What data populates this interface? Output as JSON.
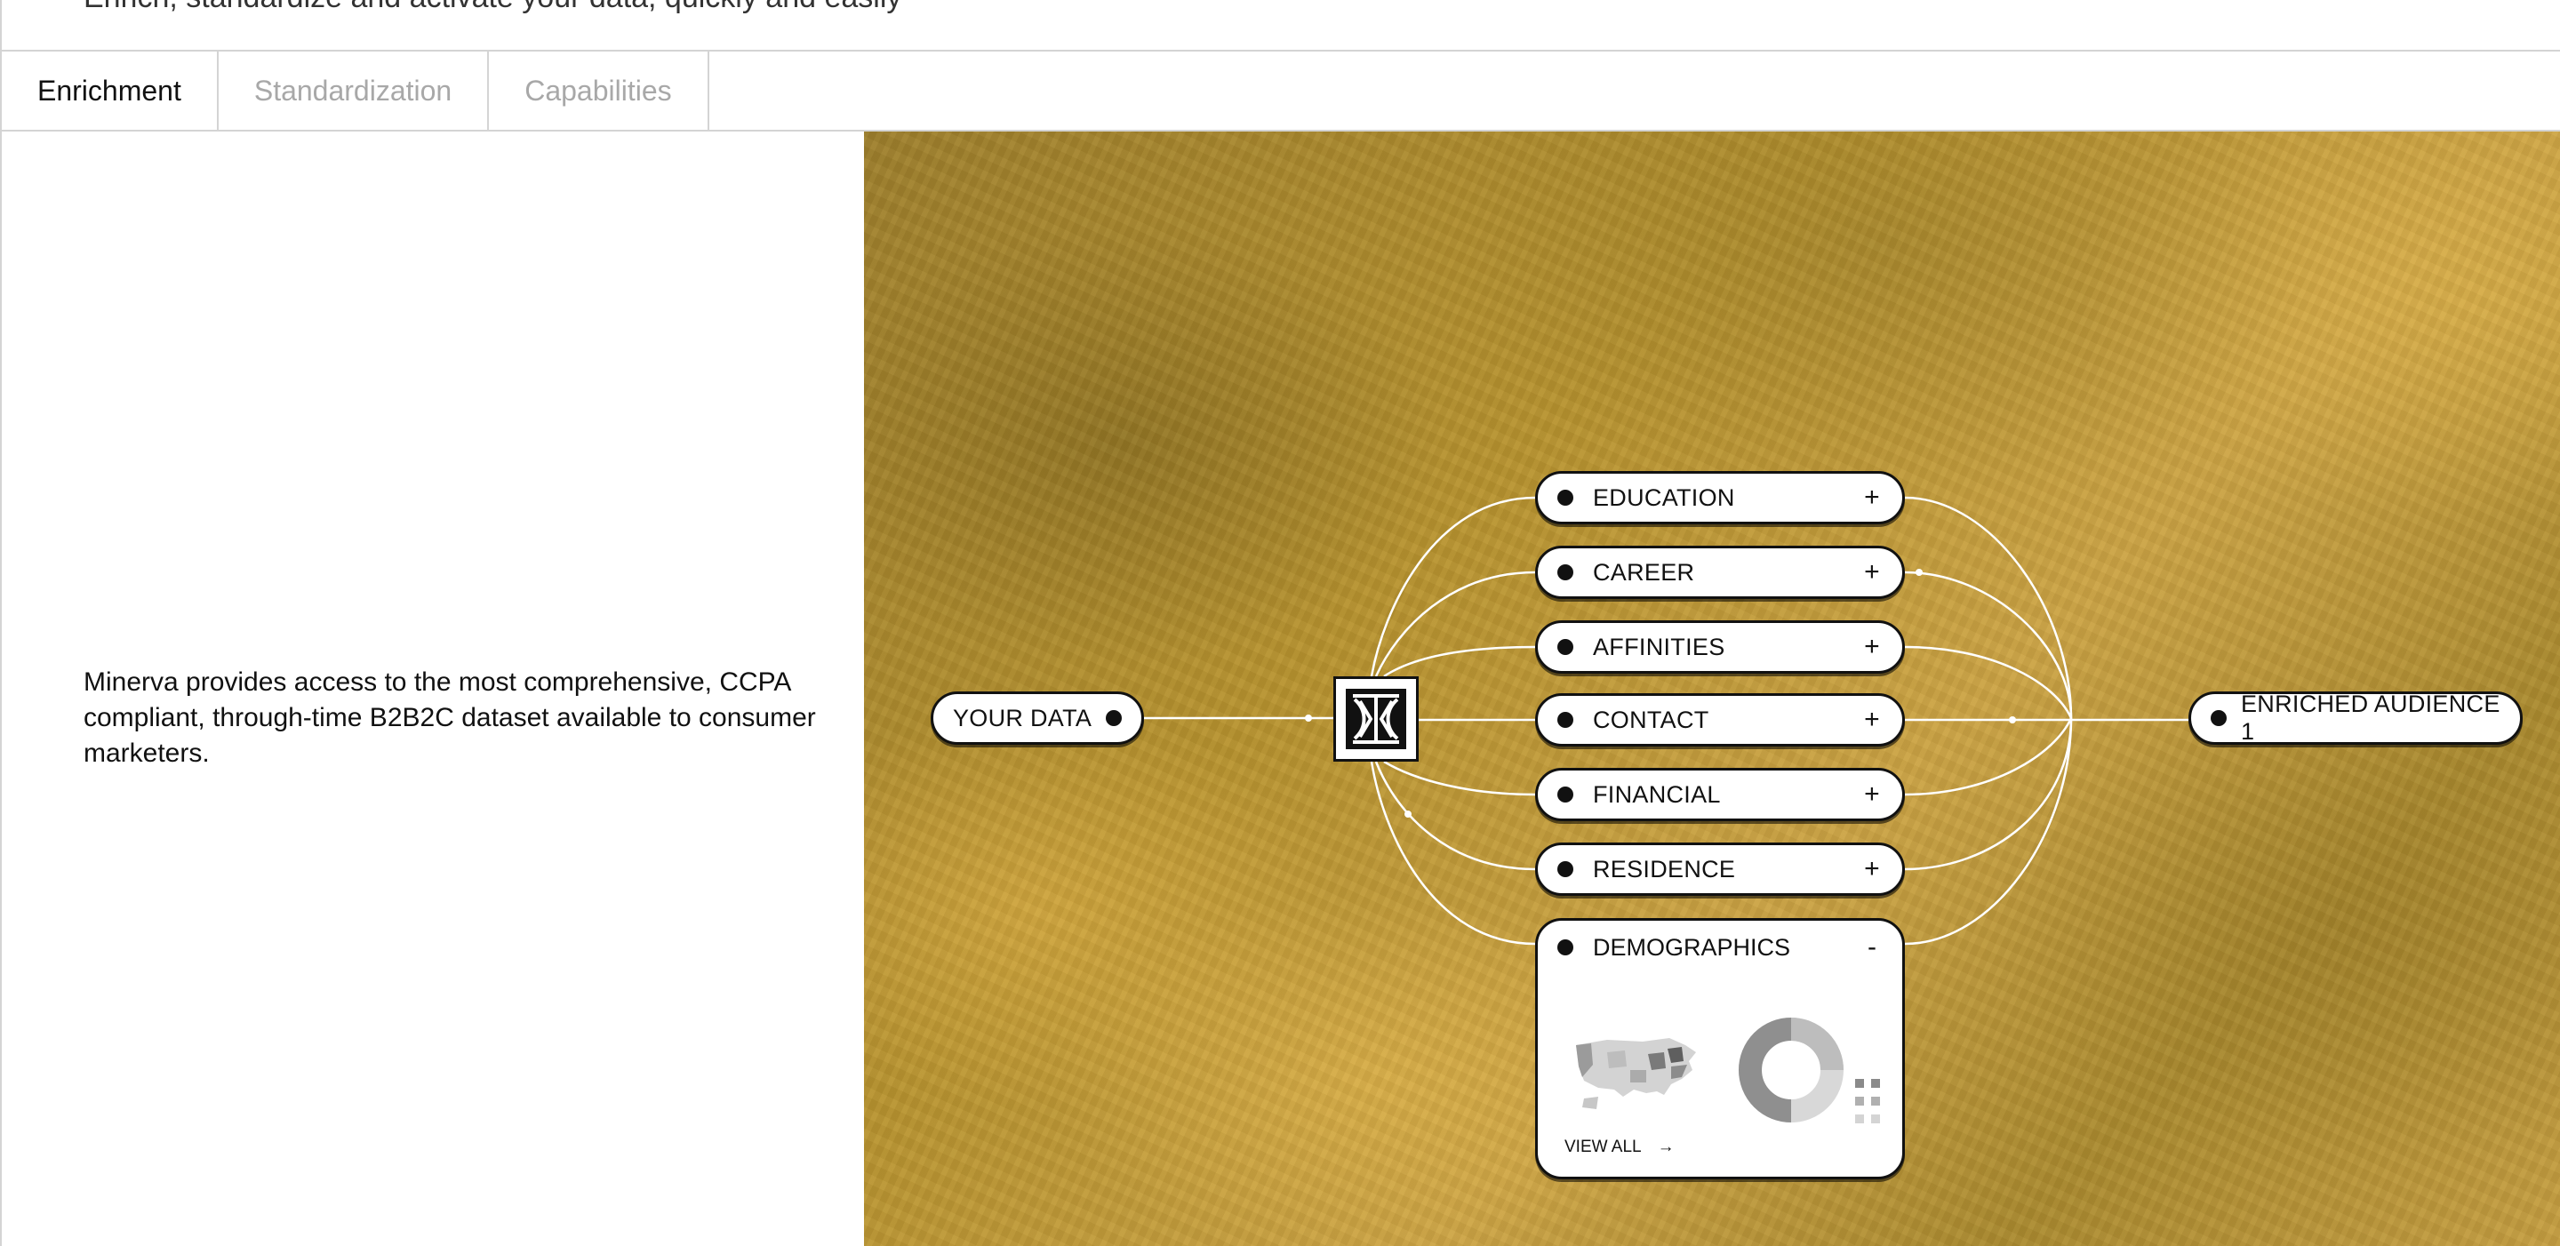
{
  "header": {
    "partial_text": "Enrich, standardize and activate your data, quickly and easily"
  },
  "tabs": [
    {
      "label": "Enrichment",
      "active": true
    },
    {
      "label": "Standardization",
      "active": false
    },
    {
      "label": "Capabilities",
      "active": false
    }
  ],
  "description": "Minerva provides access to the most comprehensive, CCPA compliant, through-time B2B2C dataset available to consumer marketers.",
  "flow": {
    "source_label": "YOUR DATA",
    "target_label": "ENRICHED AUDIENCE 1",
    "categories": [
      {
        "label": "EDUCATION",
        "toggle": "+"
      },
      {
        "label": "CAREER",
        "toggle": "+"
      },
      {
        "label": "AFFINITIES",
        "toggle": "+"
      },
      {
        "label": "CONTACT",
        "toggle": "+"
      },
      {
        "label": "FINANCIAL",
        "toggle": "+"
      },
      {
        "label": "RESIDENCE",
        "toggle": "+"
      }
    ],
    "expanded_category": {
      "label": "DEMOGRAPHICS",
      "toggle": "-",
      "view_all_label": "VIEW ALL",
      "view_all_arrow": "→"
    }
  },
  "colors": {
    "background_gold": "#b5912f",
    "pill_fill": "#ffffff",
    "pill_border": "#111111",
    "inactive_tab_text": "#a8a8a8",
    "connector_line": "#ffffff"
  },
  "icons": [
    "logo-mark-icon",
    "us-map-icon",
    "donut-chart-icon",
    "grid-dots-icon",
    "arrow-right-icon"
  ]
}
